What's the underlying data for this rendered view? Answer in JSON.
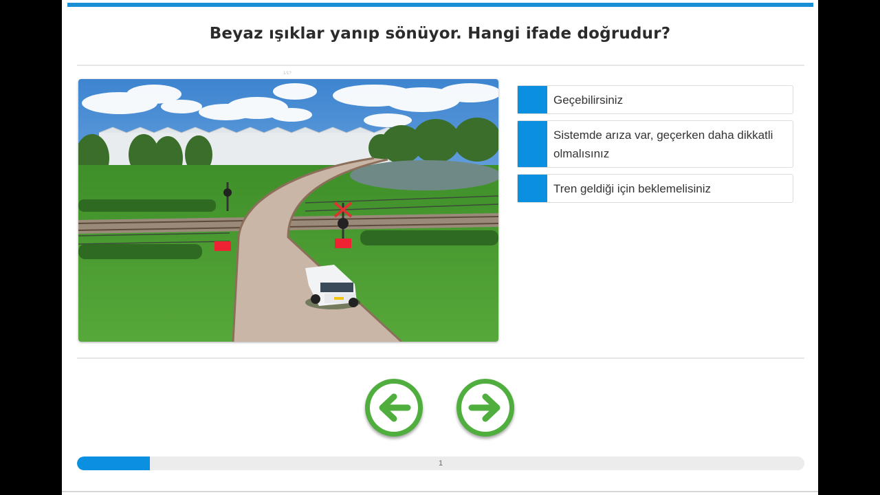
{
  "question": {
    "text": "Beyaz ışıklar yanıp sönüyor. Hangi ifade doğrudur?"
  },
  "scene": {
    "description_icon": "railway-crossing-scene-image",
    "watermark": "1/1?"
  },
  "answers": [
    {
      "label": "Geçebilirsiniz"
    },
    {
      "label": "Sistemde arıza var, geçerken daha dikkatli olmalısınız"
    },
    {
      "label": "Tren geldiği için beklemelisiniz"
    }
  ],
  "navigation": {
    "prev_icon": "arrow-left-icon",
    "next_icon": "arrow-right-icon"
  },
  "progress": {
    "current": "1",
    "fraction": 0.1
  },
  "colors": {
    "accent": "#0b8fe0",
    "nav_green": "#4fae3d",
    "top_bar": "#1a8fd6"
  }
}
